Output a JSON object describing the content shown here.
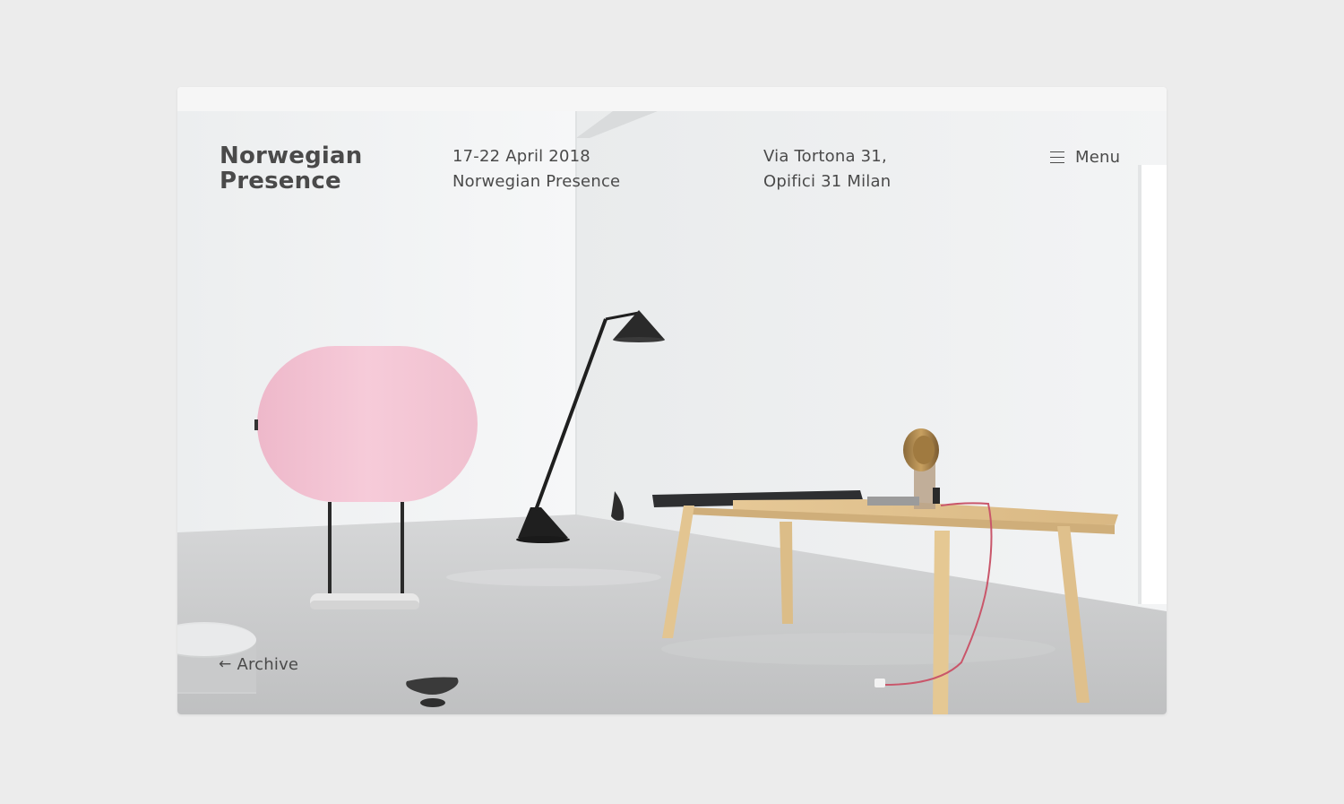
{
  "header": {
    "brand": {
      "line1": "Norwegian",
      "line2": "Presence"
    },
    "event": {
      "dates": "17-22 April 2018",
      "name": "Norwegian Presence"
    },
    "venue": {
      "line1": "Via Tortona 31,",
      "line2": "Opifici 31 Milan"
    },
    "menu": {
      "label": "Menu",
      "icon": "hamburger-menu-icon"
    }
  },
  "footer": {
    "archive": {
      "label": "Archive",
      "icon": "arrow-left-icon",
      "arrow_glyph": "←"
    }
  },
  "colors": {
    "page_background": "#ececec",
    "text": "#4a4a4a",
    "wall": "#f1f2f3",
    "floor": "#c8c9ca",
    "screen_pink": "#f2c4d3",
    "table_wood": "#e2c595",
    "lamp": "#222222"
  }
}
